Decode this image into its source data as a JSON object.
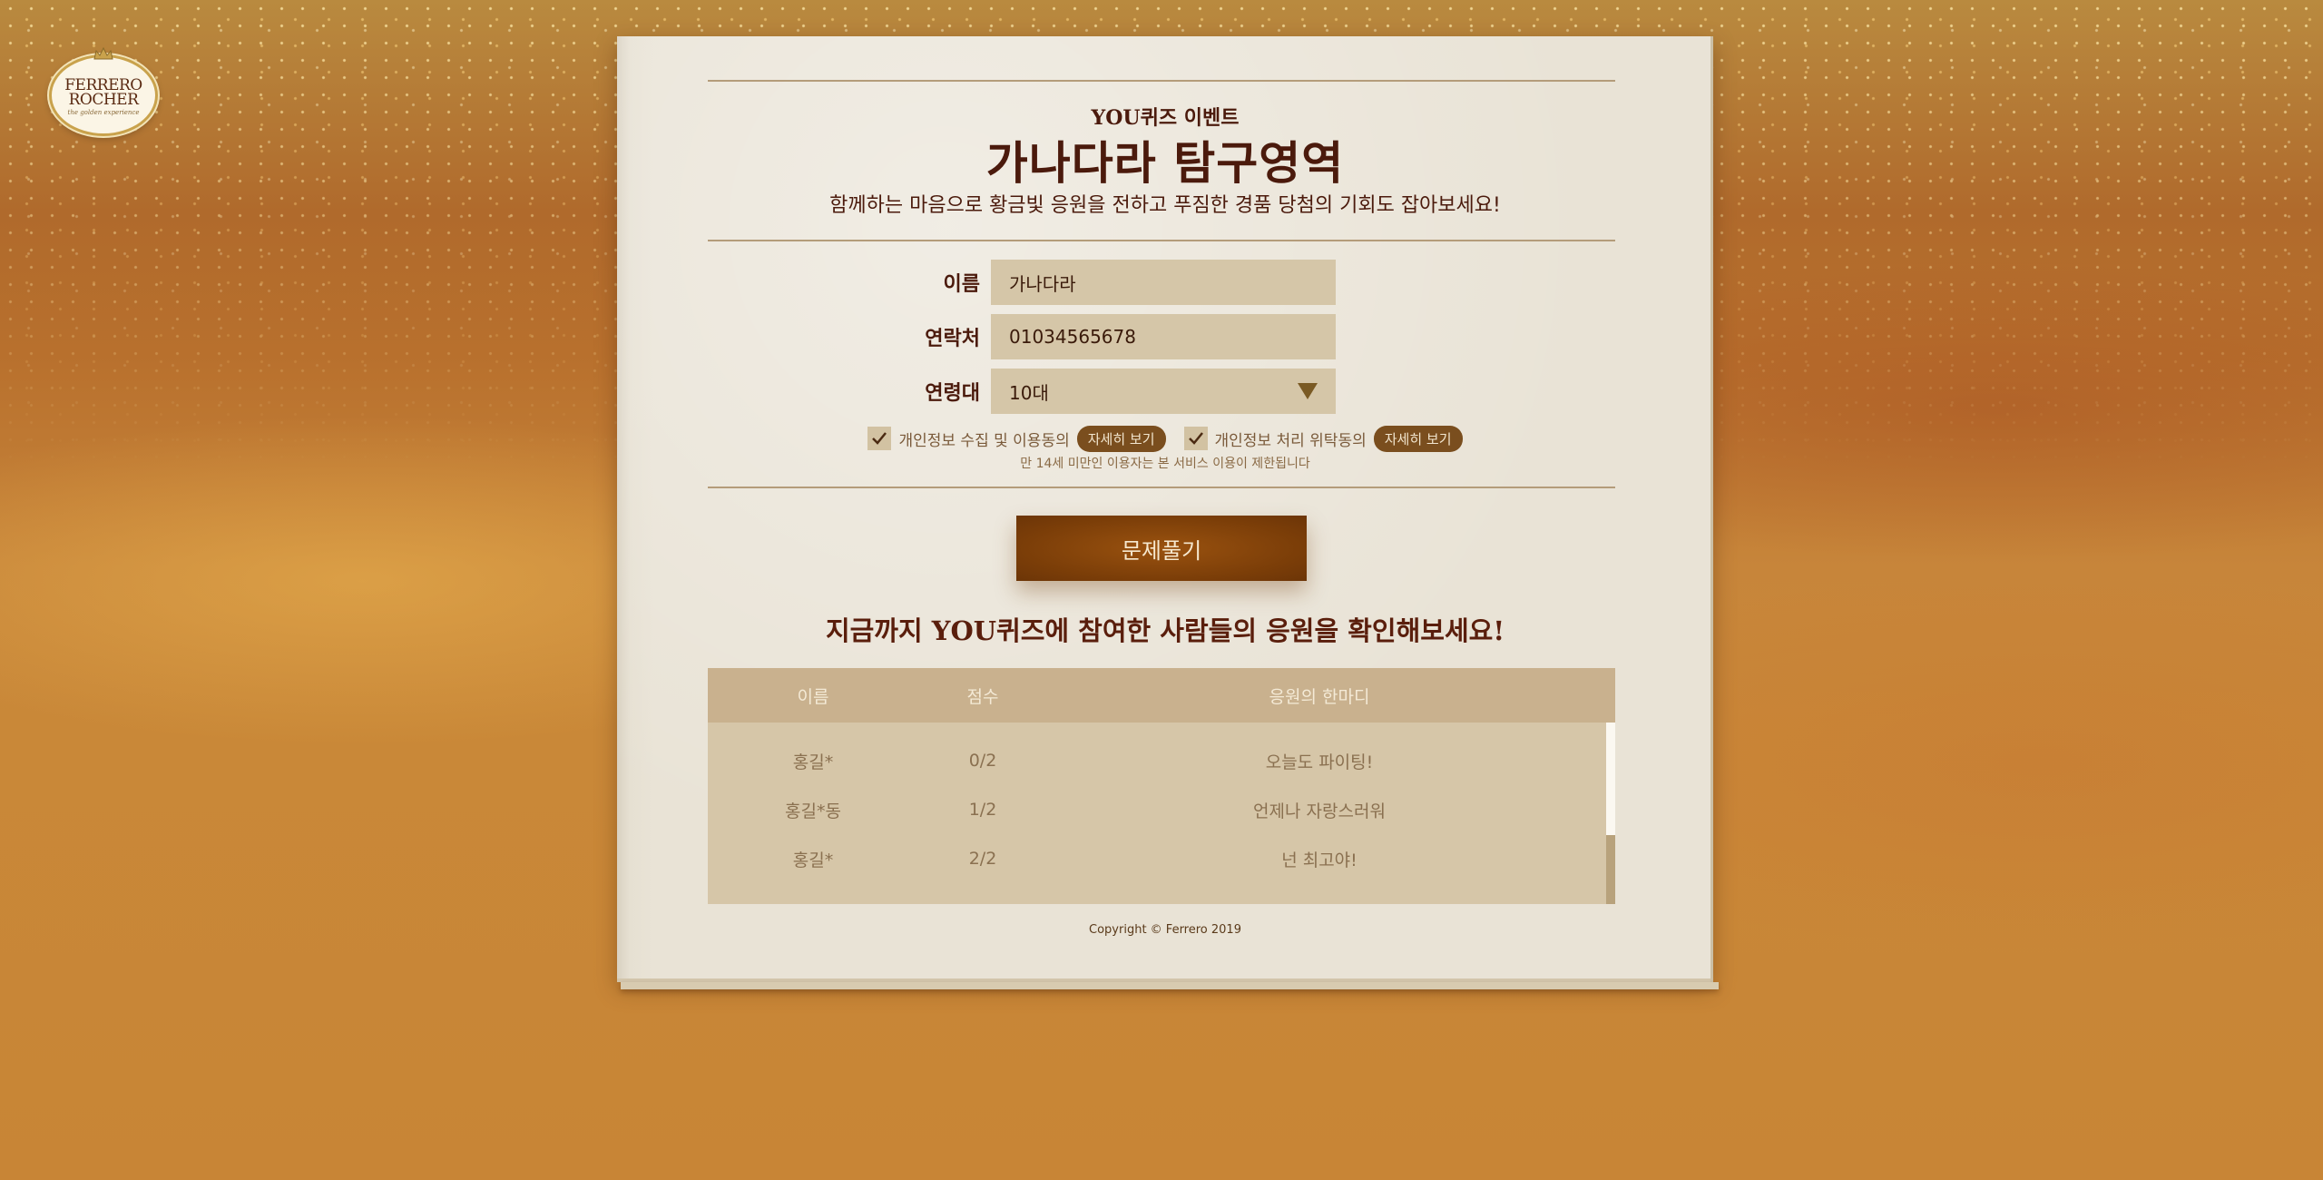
{
  "brand": {
    "logo_text_line1": "FERRERO",
    "logo_text_line2": "ROCHER",
    "logo_tagline": "the golden experience"
  },
  "event": {
    "small_title": "YOU퀴즈 이벤트",
    "big_title": "가나다라 탐구영역",
    "subtitle": "함께하는 마음으로 황금빛 응원을 전하고 푸짐한 경품 당첨의 기회도 잡아보세요!"
  },
  "form": {
    "name_label": "이름",
    "name_value": "가나다라",
    "phone_label": "연락처",
    "phone_value": "01034565678",
    "age_label": "연령대",
    "age_value": "10대"
  },
  "agreements": [
    {
      "text": "개인정보 수집 및 이용동의",
      "checked": true,
      "detail_label": "자세히 보기"
    },
    {
      "text": "개인정보 처리 위탁동의",
      "checked": true,
      "detail_label": "자세히 보기"
    }
  ],
  "notice": "만 14세 미만인 이용자는 본 서비스 이용이 제한됩니다",
  "submit_label": "문제풀기",
  "results": {
    "heading": "지금까지 YOU퀴즈에 참여한 사람들의 응원을 확인해보세요!",
    "columns": {
      "name": "이름",
      "score": "점수",
      "message": "응원의 한마디"
    },
    "rows": [
      {
        "name": "홍길*",
        "score": "0/2",
        "message": "오늘도 파이팅!"
      },
      {
        "name": "홍길*동",
        "score": "1/2",
        "message": "언제나 자랑스러워"
      },
      {
        "name": "홍길*",
        "score": "2/2",
        "message": "넌 최고야!"
      }
    ]
  },
  "copyright": "Copyright © Ferrero 2019",
  "colors": {
    "primary_brown": "#4b1a0c",
    "button_brown": "#7a3d08",
    "input_bg": "#d5c6a8",
    "paper": "#e8e2d4"
  }
}
